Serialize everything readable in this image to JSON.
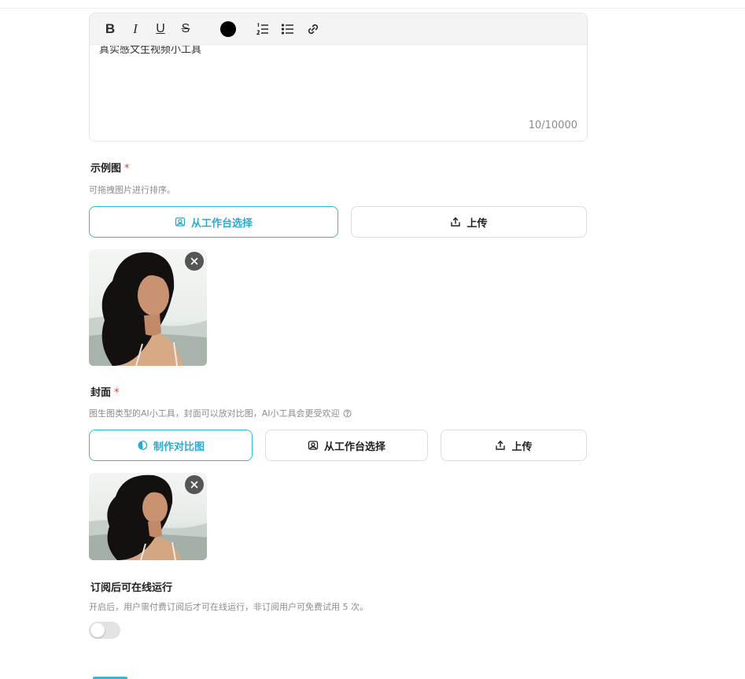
{
  "editor": {
    "toolbar": [
      "bold-icon",
      "italic-icon",
      "underline-icon",
      "strikethrough-icon",
      "text-color-icon",
      "ordered-list-icon",
      "bullet-list-icon",
      "link-icon"
    ],
    "toolbar_glyphs": {
      "bold": "B",
      "italic": "I",
      "underline": "U",
      "strike": "S"
    },
    "text_color": "#000000",
    "content": "真实感文生视频小工具",
    "counter": "10/10000"
  },
  "examples": {
    "label": "示例图",
    "required_mark": "*",
    "hint": "可拖拽图片进行排序。",
    "buttons": {
      "workspace": "从工作台选择",
      "upload": "上传"
    }
  },
  "cover": {
    "label": "封面",
    "required_mark": "*",
    "hint": "图生图类型的AI小工具，封面可以放对比图，AI小工具会更受欢迎",
    "buttons": {
      "compare": "制作对比图",
      "workspace": "从工作台选择",
      "upload": "上传"
    }
  },
  "subscription": {
    "label": "订阅后可在线运行",
    "hint": "开启后，用户需付费订阅后才可在线运行，非订阅用户可免费试用 5 次。",
    "toggle_on": false
  },
  "colors": {
    "accent": "#34b7d9",
    "required": "#e23b3b"
  }
}
